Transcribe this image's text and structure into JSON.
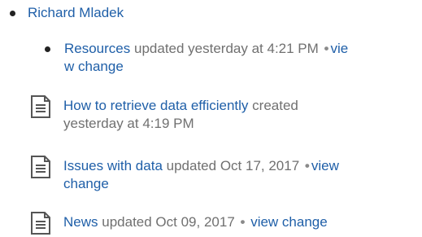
{
  "author": {
    "name": "Richard Mladek"
  },
  "items": [
    {
      "title": "Resources",
      "status": "updated yesterday at 4:21 PM",
      "separator": "•",
      "link_part1": "vie",
      "link_part2": "w change",
      "icon": "bullet"
    },
    {
      "title": "How to retrieve data efficiently",
      "status_part1": "created",
      "status_part2": "yesterday at 4:19 PM",
      "icon": "page-icon"
    },
    {
      "title": "Issues with data",
      "status": "updated Oct 17, 2017",
      "separator": "•",
      "link_part1": "view",
      "link_part2": "change",
      "icon": "page-icon"
    },
    {
      "title": "News",
      "status": "updated Oct 09, 2017",
      "separator": "•",
      "link": "view change",
      "icon": "page-icon"
    }
  ],
  "colors": {
    "link": "#1f5fa8",
    "muted": "#707070"
  }
}
